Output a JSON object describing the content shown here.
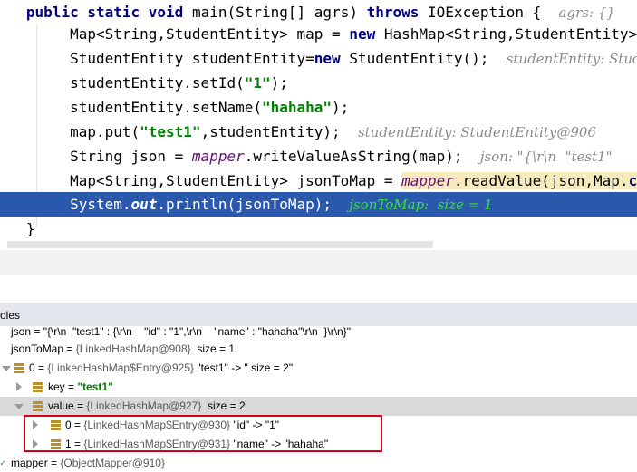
{
  "editor": {
    "line1": {
      "kw1": "public static void ",
      "rest": "main(String[] agrs) ",
      "kw2": "throws ",
      "rest2": "IOException {",
      "hint": "agrs: {}"
    },
    "line2": {
      "a": "Map<String,StudentEntity> map = ",
      "kw": "new ",
      "b": "HashMap<String,StudentEntity>();"
    },
    "line3": {
      "a": "StudentEntity studentEntity=",
      "kw": "new ",
      "b": "StudentEntity();",
      "hint": "studentEntity: Stud"
    },
    "line4": {
      "a": "studentEntity.setId(",
      "str": "\"1\"",
      "b": ");"
    },
    "line5": {
      "a": "studentEntity.setName(",
      "str": "\"hahaha\"",
      "b": ");"
    },
    "line6": {
      "a": "map.put(",
      "str": "\"test1\"",
      "b": ",studentEntity);",
      "hint": "studentEntity: StudentEntity@906"
    },
    "line7": {
      "a": "String json = ",
      "fld": "mapper",
      "b": ".writeValueAsString(map);",
      "hint": "json: \"{\\r\\n  \"test1\""
    },
    "line8": {
      "a": "Map<String,StudentEntity> jsonToMap = ",
      "fld": "mapper",
      "b": ".readValue(json,Map.",
      "kw": "class"
    },
    "line9": {
      "a": "System.",
      "out": "out",
      "b": ".println(jsonToMap);",
      "hint": "jsonToMap:  size = 1"
    },
    "line10": {
      "a": "}"
    }
  },
  "panel": {
    "title": "oles"
  },
  "tree": {
    "json": {
      "name": "json",
      "value": " = \"{\\r\\n  \"test1\" : {\\r\\n    \"id\" : \"1\",\\r\\n    \"name\" : \"hahaha\"\\r\\n  }\\r\\n}\""
    },
    "jsonToMap": {
      "name": "jsonToMap",
      "eq": " = ",
      "ref": "{LinkedHashMap@908}",
      "extra": "  size = 1"
    },
    "entry0": {
      "name": "0",
      "eq": " = ",
      "ref": "{LinkedHashMap$Entry@925}",
      "extra": " \"test1\" -> \" size = 2\""
    },
    "key": {
      "name": "key",
      "eq": " = ",
      "val": "\"test1\""
    },
    "value": {
      "name": "value",
      "eq": " = ",
      "ref": "{LinkedHashMap@927}",
      "extra": "  size = 2"
    },
    "child0": {
      "name": "0",
      "eq": " = ",
      "ref": "{LinkedHashMap$Entry@930}",
      "extra": " \"id\" -> \"1\""
    },
    "child1": {
      "name": "1",
      "eq": " = ",
      "ref": "{LinkedHashMap$Entry@931}",
      "extra": " \"name\" -> \"hahaha\""
    },
    "mapper": {
      "name": "mapper",
      "eq": " = ",
      "ref": "{ObjectMapper@910}"
    }
  }
}
